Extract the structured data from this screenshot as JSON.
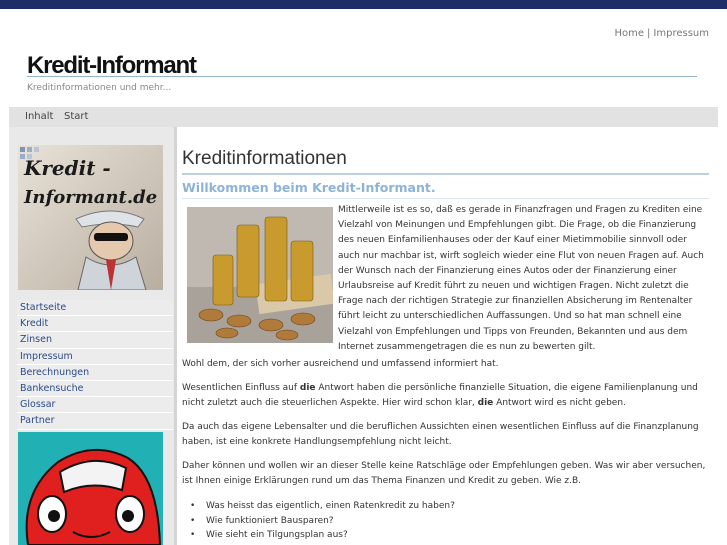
{
  "header": {
    "title": "Kredit-Informant",
    "subtitle": "Kreditinformationen und mehr...",
    "top_links": [
      "Home",
      "Impressum"
    ],
    "top_separator": "|"
  },
  "nav": {
    "items": [
      "Inhalt",
      "Start"
    ]
  },
  "sidebar": {
    "logo_lines": [
      "Kredit -",
      "Informant.de"
    ],
    "menu": [
      "Startseite",
      "Kredit",
      "Zinsen",
      "Impressum",
      "Berechnungen",
      "Bankensuche",
      "Glossar",
      "Partner"
    ]
  },
  "main": {
    "title": "Kreditinformationen",
    "welcome": "Willkommen beim Kredit-Informant.",
    "intro": "Mittlerweile ist es so, daß es gerade in Finanzfragen und Fragen zu Krediten eine Vielzahl von Meinungen und Empfehlungen gibt. Die Frage, ob die Finanzierung des neuen Einfamilienhauses oder der Kauf einer Mietimmobilie sinnvoll oder auch nur machbar ist, wirft sogleich wieder eine Flut von neuen Fragen auf. Auch der Wunsch nach der Finanzierung eines Autos oder der Finanzierung einer Urlaubsreise auf Kredit führt zu neuen und wichtigen Fragen. Nicht zuletzt die Frage nach der richtigen Strategie zur finanziellen Absicherung im Rentenalter führt leicht zu unterschiedlichen Auffassungen. Und so hat man schnell eine Vielzahl von Empfehlungen und Tipps von Freunden, Bekannten und aus dem Internet zusammengetragen die es nun zu bewerten gilt.",
    "p1": "Wohl dem, der sich vorher ausreichend und umfassend informiert hat.",
    "p2_a": "Wesentlichen Einfluss auf ",
    "p2_b": "die",
    "p2_c": " Antwort haben die persönliche finanzielle Situation, die eigene Familienplanung und nicht zuletzt auch die steuerlichen Aspekte. Hier wird schon klar, ",
    "p2_d": "die",
    "p2_e": " Antwort wird es nicht geben.",
    "p3": "Da auch das eigene Lebensalter und die beruflichen Aussichten einen wesentlichen Einfluss auf die Finanzplanung haben, ist eine konkrete Handlungsempfehlung nicht leicht.",
    "p4": "Daher können und wollen wir an dieser Stelle keine Ratschläge oder Empfehlungen geben. Was wir aber versuchen, ist Ihnen einige Erklärungen rund um das Thema Finanzen und Kredit zu geben. Wie z.B.",
    "bullets": [
      "Was heisst das eigentlich, einen Ratenkredit zu haben?",
      "Wie funktioniert Bausparen?",
      "Wie sieht ein Tilgungsplan aus?"
    ]
  },
  "colors": {
    "topbar": "#1d2d68",
    "accent_link": "#2a4a8a",
    "welcome": "#8db3d9"
  }
}
